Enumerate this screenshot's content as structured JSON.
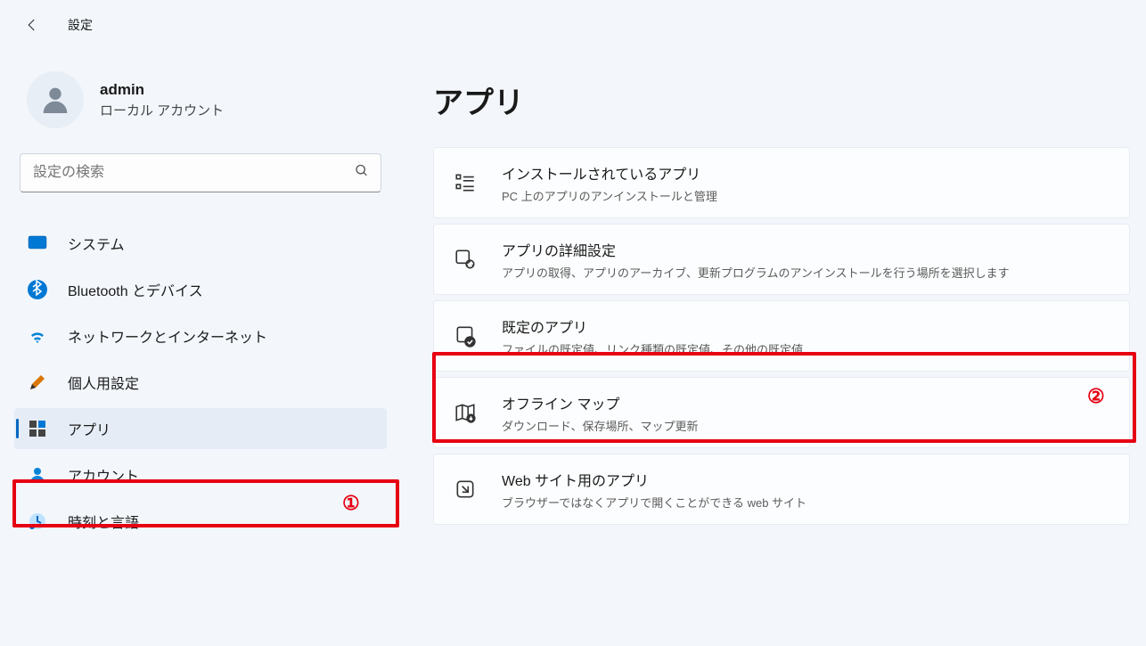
{
  "header": {
    "title": "設定"
  },
  "account": {
    "name": "admin",
    "type": "ローカル アカウント"
  },
  "search": {
    "placeholder": "設定の検索"
  },
  "sidebar": {
    "items": [
      {
        "label": "システム",
        "icon": "system"
      },
      {
        "label": "Bluetooth とデバイス",
        "icon": "bluetooth"
      },
      {
        "label": "ネットワークとインターネット",
        "icon": "network"
      },
      {
        "label": "個人用設定",
        "icon": "personalization"
      },
      {
        "label": "アプリ",
        "icon": "apps",
        "active": true
      },
      {
        "label": "アカウント",
        "icon": "accounts"
      },
      {
        "label": "時刻と言語",
        "icon": "time"
      }
    ]
  },
  "page": {
    "title": "アプリ"
  },
  "cards": [
    {
      "title": "インストールされているアプリ",
      "desc": "PC 上のアプリのアンインストールと管理",
      "icon": "installed"
    },
    {
      "title": "アプリの詳細設定",
      "desc": "アプリの取得、アプリのアーカイブ、更新プログラムのアンインストールを行う場所を選択します",
      "icon": "advanced"
    },
    {
      "title": "既定のアプリ",
      "desc": "ファイルの既定値、リンク種類の既定値、その他の既定値",
      "icon": "default"
    },
    {
      "title": "オフライン マップ",
      "desc": "ダウンロード、保存場所、マップ更新",
      "icon": "maps"
    },
    {
      "title": "Web サイト用のアプリ",
      "desc": "ブラウザーではなくアプリで開くことができる web サイト",
      "icon": "web"
    }
  ],
  "annotations": {
    "1": "①",
    "2": "②"
  }
}
